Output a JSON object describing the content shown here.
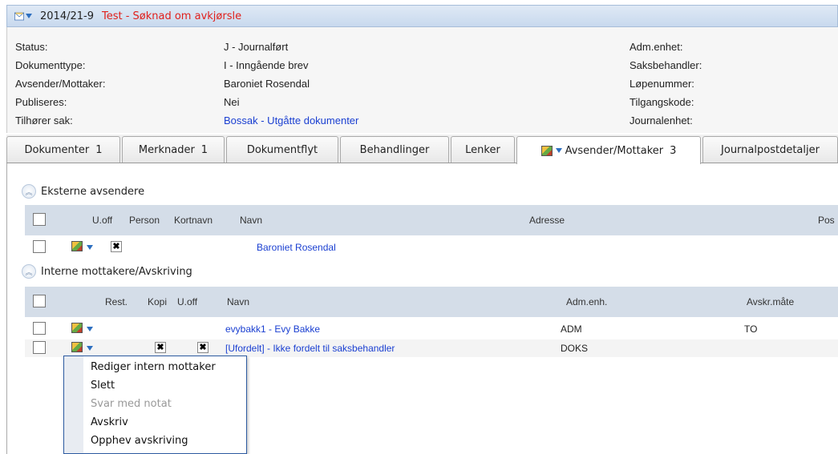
{
  "header": {
    "case_number": "2014/21-9",
    "title": "Test - Søknad om avkjørsle",
    "icon": "envelope-icon",
    "accent": "#e0201c"
  },
  "meta": {
    "left": [
      {
        "label": "Status:",
        "value": "J - Journalført"
      },
      {
        "label": "Dokumenttype:",
        "value": "I - Inngående brev"
      },
      {
        "label": "Avsender/Mottaker:",
        "value": "Baroniet Rosendal"
      },
      {
        "label": "Publiseres:",
        "value": "Nei"
      },
      {
        "label": "Tilhører sak:",
        "value": "Bossak - Utgåtte dokumenter"
      }
    ],
    "right": [
      "Adm.enhet:",
      "Saksbehandler:",
      "Løpenummer:",
      "Tilgangskode:",
      "Journalenhet:"
    ]
  },
  "tabs": [
    {
      "label": "Dokumenter",
      "count": "1"
    },
    {
      "label": "Merknader",
      "count": "1"
    },
    {
      "label": "Dokumentflyt",
      "count": ""
    },
    {
      "label": "Behandlinger",
      "count": ""
    },
    {
      "label": "Lenker",
      "count": ""
    },
    {
      "label": "Avsender/Mottaker",
      "count": "3"
    },
    {
      "label": "Journalpostdetaljer",
      "count": ""
    }
  ],
  "external": {
    "title": "Eksterne avsendere",
    "columns": [
      "U.off",
      "Person",
      "Kortnavn",
      "Navn",
      "Adresse",
      "Pos"
    ],
    "rows": [
      {
        "name": "Baroniet Rosendal",
        "u_off": true
      }
    ]
  },
  "internal": {
    "title": "Interne mottakere/Avskriving",
    "columns": [
      "Rest.",
      "Kopi",
      "U.off",
      "Navn",
      "Adm.enh.",
      "Avskr.måte"
    ],
    "rows": [
      {
        "name": "evybakk1 - Evy Bakke",
        "adm": "ADM",
        "avskr": "TO",
        "kopi": false,
        "u_off": false
      },
      {
        "name": "[Ufordelt] - Ikke fordelt til saksbehandler",
        "adm": "DOKS",
        "avskr": "",
        "kopi": true,
        "u_off": true
      }
    ]
  },
  "context_menu": [
    {
      "label": "Rediger intern mottaker",
      "enabled": true
    },
    {
      "label": "Slett",
      "enabled": true
    },
    {
      "label": "Svar med notat",
      "enabled": false
    },
    {
      "label": "Avskriv",
      "enabled": true
    },
    {
      "label": "Opphev avskriving",
      "enabled": true
    }
  ]
}
